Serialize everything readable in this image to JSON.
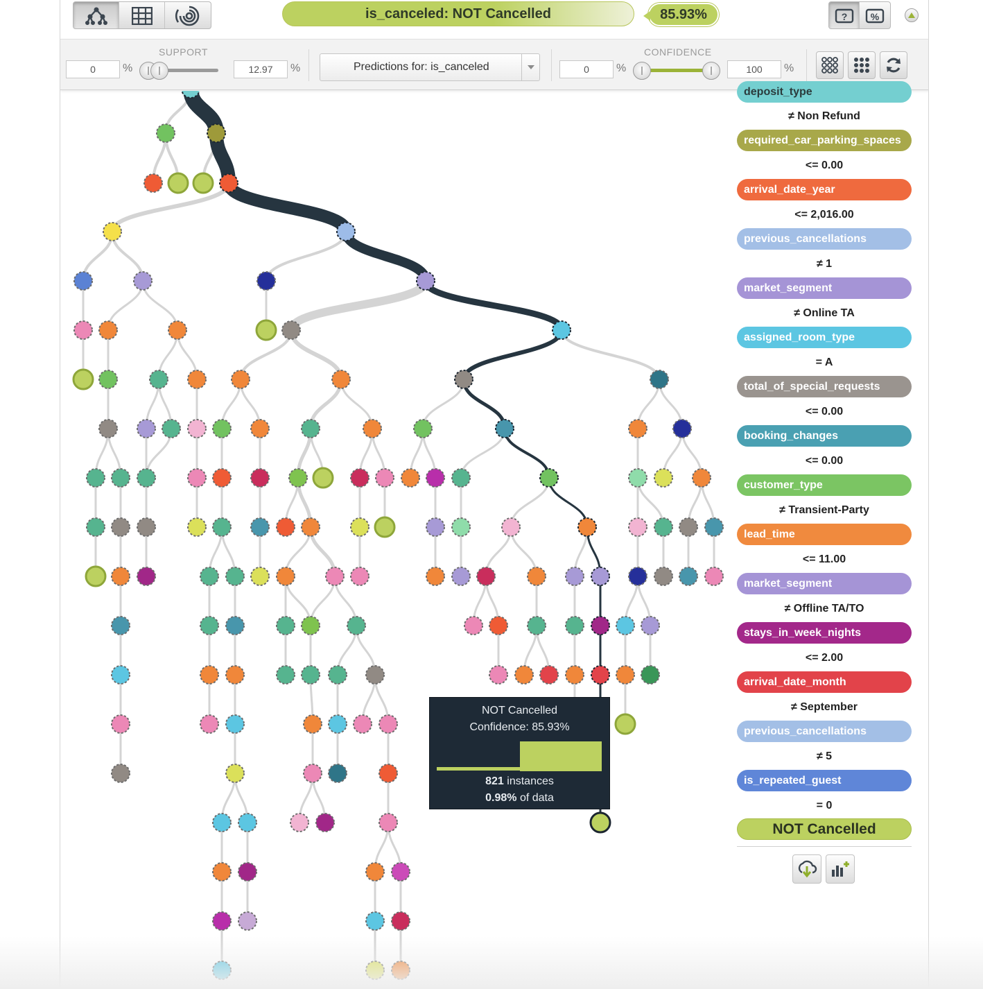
{
  "toolbar": {
    "view_buttons": [
      "tree-view-icon",
      "grid-view-icon",
      "sunburst-view-icon"
    ],
    "prediction_label": "is_canceled: NOT Cancelled",
    "confidence_badge": "85.93%",
    "right_buttons": [
      "question-view-icon",
      "percent-view-icon"
    ],
    "collapse_icon": "collapse-up-icon"
  },
  "filters": {
    "support": {
      "label": "SUPPORT",
      "min": "0",
      "max": "12.97",
      "unit": "%"
    },
    "predictions_select": "Predictions for: is_canceled",
    "confidence": {
      "label": "CONFIDENCE",
      "min": "0",
      "max": "100",
      "unit": "%"
    },
    "buttons": [
      "expand-nodes-icon",
      "compact-nodes-icon",
      "refresh-icon"
    ]
  },
  "path": {
    "partial_top_attribute": "deposit_type",
    "steps": [
      {
        "condition": "≠ Non Refund",
        "attribute": "required_car_parking_spaces",
        "color": "#a8a84a"
      },
      {
        "condition": "<= 0.00",
        "attribute": "arrival_date_year",
        "color": "#ef6a3e"
      },
      {
        "condition": "<= 2,016.00",
        "attribute": "previous_cancellations",
        "color": "#a3bfe6"
      },
      {
        "condition": "≠ 1",
        "attribute": "market_segment",
        "color": "#a594d6"
      },
      {
        "condition": "≠ Online TA",
        "attribute": "assigned_room_type",
        "color": "#5cc6e2"
      },
      {
        "condition": "= A",
        "attribute": "total_of_special_requests",
        "color": "#9a948f"
      },
      {
        "condition": "<= 0.00",
        "attribute": "booking_changes",
        "color": "#4aa0b2"
      },
      {
        "condition": "<= 0.00",
        "attribute": "customer_type",
        "color": "#7bc563"
      },
      {
        "condition": "≠ Transient-Party",
        "attribute": "lead_time",
        "color": "#f08a3e"
      },
      {
        "condition": "<= 11.00",
        "attribute": "market_segment",
        "color": "#a594d6"
      },
      {
        "condition": "≠ Offline TA/TO",
        "attribute": "stays_in_week_nights",
        "color": "#a3288a"
      },
      {
        "condition": "<= 2.00",
        "attribute": "arrival_date_month",
        "color": "#e2434a"
      },
      {
        "condition": "≠ September",
        "attribute": "previous_cancellations",
        "color": "#a3bfe6"
      },
      {
        "condition": "≠ 5",
        "attribute": "is_repeated_guest",
        "color": "#5f86d8"
      }
    ],
    "final_condition": "= 0",
    "final_prediction": "NOT Cancelled",
    "panel_buttons": [
      "download-icon",
      "add-chart-icon"
    ]
  },
  "tooltip": {
    "title": "NOT Cancelled",
    "confidence": "Confidence: 85.93%",
    "instances_value": "821",
    "instances_label": " instances",
    "data_value": "0.98%",
    "data_label": " of data",
    "fill_fraction": 0.8593
  },
  "colors": {
    "accent_green": "#bcd160",
    "path_dark": "#263540",
    "tooltip_bg": "#1e2a36"
  }
}
